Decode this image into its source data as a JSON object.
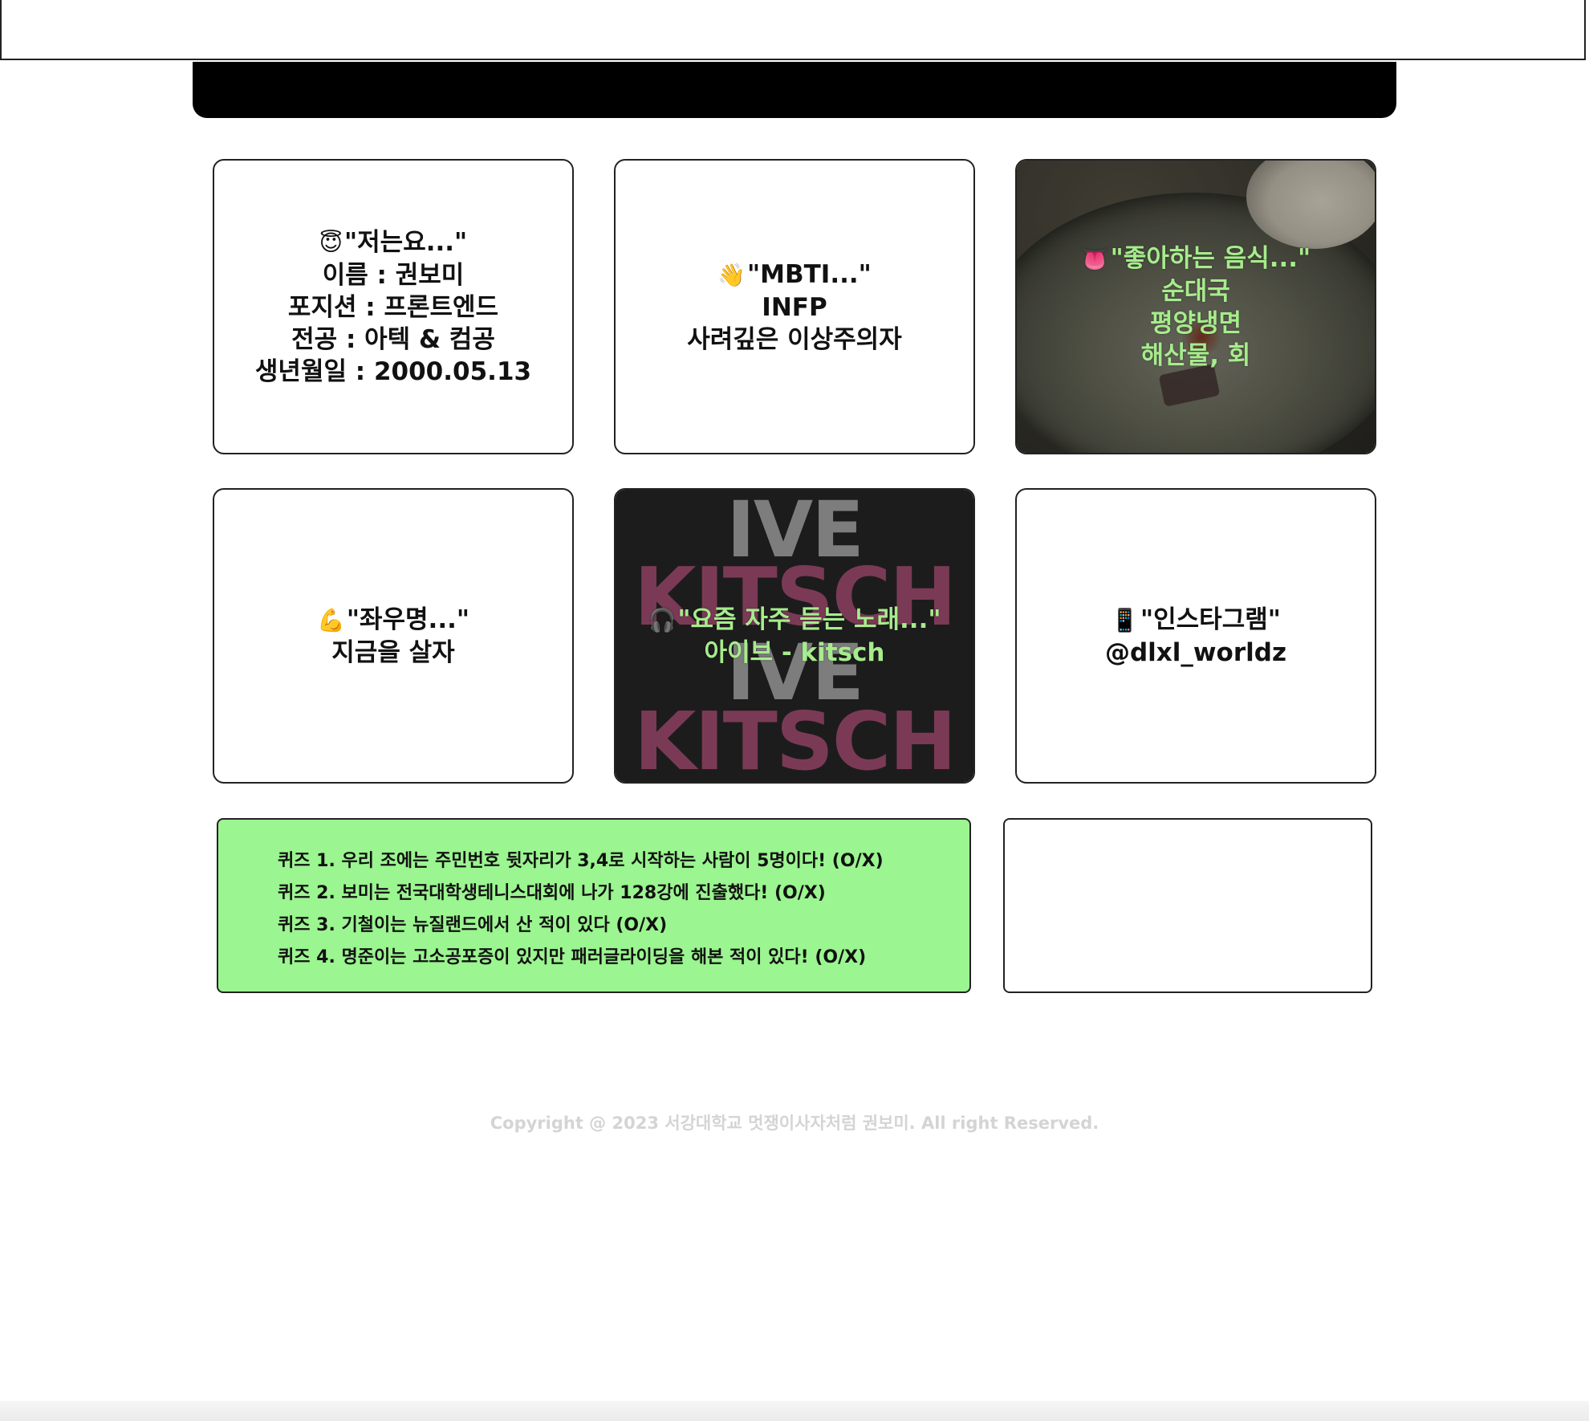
{
  "cards": [
    {
      "emoji": "😇",
      "lines": [
        "\"저는요...\"",
        "이름 : 권보미",
        "포지션 : 프론트엔드",
        "전공 : 아텍 & 컴공",
        "생년월일 : 2000.05.13"
      ]
    },
    {
      "emoji": "👋",
      "lines": [
        "\"MBTI...\"",
        "INFP",
        "사려깊은 이상주의자"
      ]
    },
    {
      "emoji": "👅",
      "lines": [
        "\"좋아하는 음식...\"",
        "순대국",
        "평양냉면",
        "해산물, 회"
      ]
    },
    {
      "emoji": "💪",
      "lines": [
        "\"좌우명...\"",
        "지금을 살자"
      ]
    },
    {
      "emoji": "🎧",
      "lines": [
        "\"요즘 자주 듣는 노래...\"",
        "아이브 - kitsch"
      ],
      "album_words": [
        "IVE",
        "KITSCH",
        "IVE",
        "KITSCH"
      ]
    },
    {
      "emoji": "📱",
      "lines": [
        "\"인스타그램\"",
        "@dlxl_worldz"
      ]
    }
  ],
  "quiz": [
    "퀴즈 1. 우리 조에는 주민번호 뒷자리가 3,4로 시작하는 사람이 5명이다! (O/X)",
    "퀴즈 2. 보미는 전국대학생테니스대회에 나가 128강에 진출했다! (O/X)",
    "퀴즈 3. 기철이는 뉴질랜드에서 산 적이 있다 (O/X)",
    "퀴즈 4. 명준이는 고소공포증이 있지만 패러글라이딩을 해본 적이 있다! (O/X)"
  ],
  "footer": {
    "copyright": "Copyright @ 2023 서강대학교 멋쟁이사자처럼 권보미. All right Reserved."
  },
  "colors": {
    "quiz_bg": "#9bf590",
    "highlight_text": "#a6ec8c",
    "header_bar": "#000000"
  }
}
